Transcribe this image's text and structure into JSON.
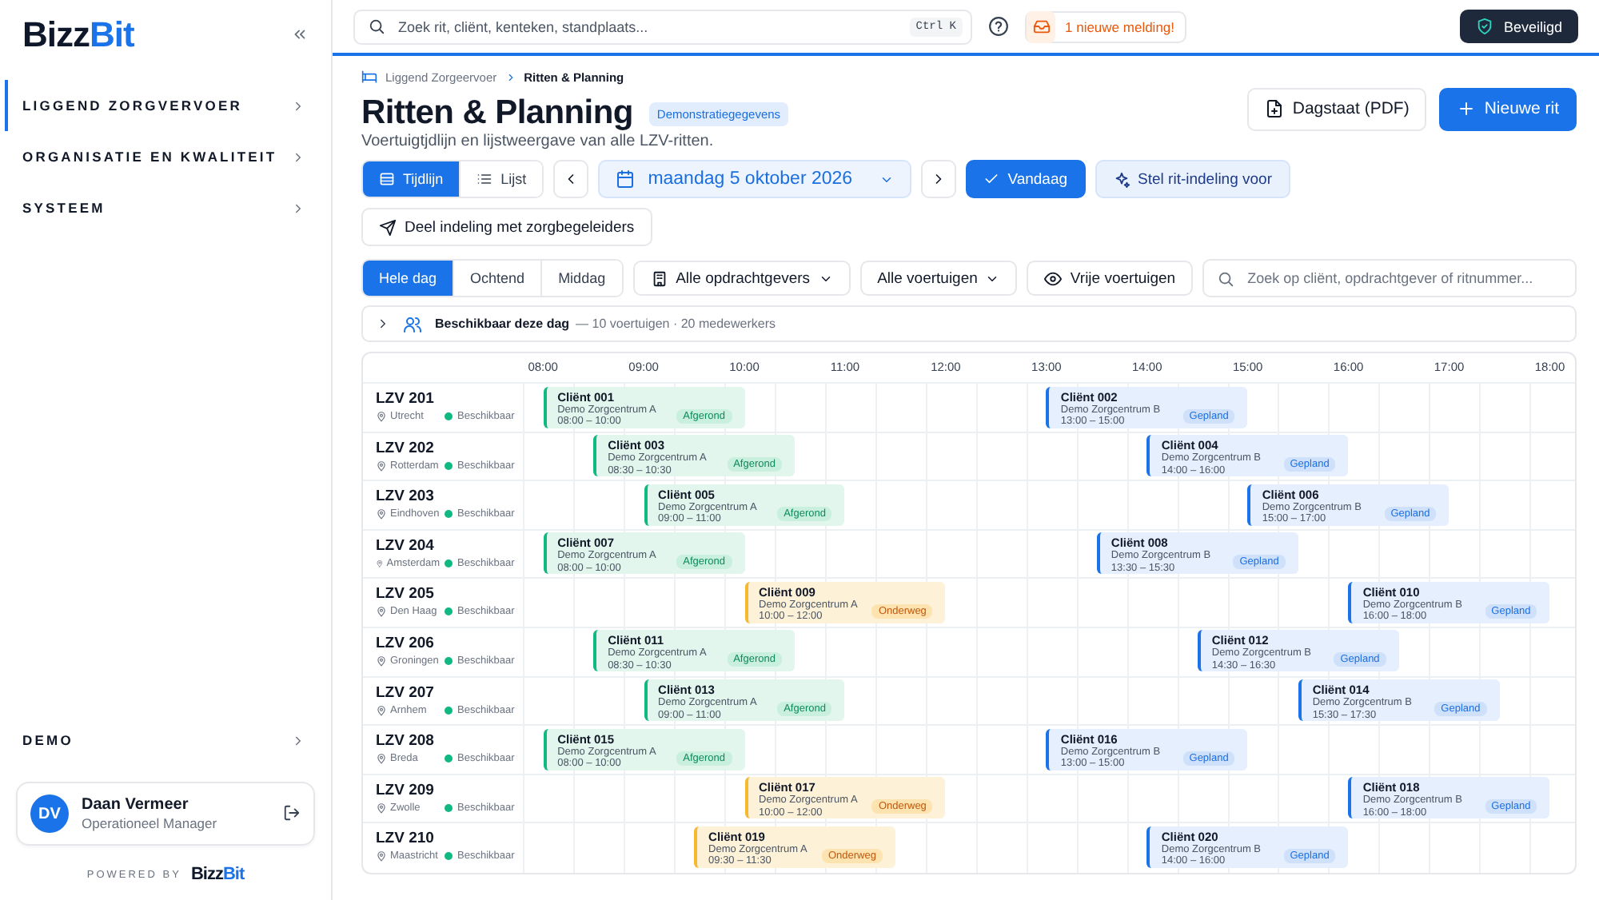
{
  "sidebar": {
    "logo": [
      "Bizz",
      "Bit"
    ],
    "items": [
      {
        "label": "LIGGEND ZORGVERVOER",
        "selected": true
      },
      {
        "label": "ORGANISATIE EN KWALITEIT",
        "selected": false
      },
      {
        "label": "SYSTEEM",
        "selected": false
      }
    ],
    "bottom_item": {
      "label": "DEMO"
    },
    "user": {
      "initials": "DV",
      "name": "Daan Vermeer",
      "role": "Operationeel Manager"
    },
    "powered_by": "POWERED BY",
    "powered_logo": [
      "Bizz",
      "Bit"
    ]
  },
  "topbar": {
    "search": {
      "placeholder": "Zoek rit, cliënt, kenteken, standplaats...",
      "shortcut": "Ctrl K"
    },
    "notification": "1 nieuwe melding!",
    "security": "Beveiligd"
  },
  "breadcrumb": [
    "Liggend Zorgeervoer",
    "Ritten & Planning"
  ],
  "title": "Ritten & Planning",
  "badge": "Demonstratiegegevens",
  "subtitle": "Voertuigtjdlijn en lijstweergave van alle LZV-ritten.",
  "actions": [
    "Dagstaat (PDF)",
    "Nieuwe rit"
  ],
  "views": [
    {
      "label": "Tijdlijn",
      "selected": true
    },
    {
      "label": "Lijst",
      "selected": false
    }
  ],
  "date": "maandag 5 oktober 2026",
  "today": "Vandaag",
  "suggest": "Stel rit-indeling voor",
  "share": "Deel indeling met zorgbegeleiders",
  "periods": [
    {
      "label": "Hele dag",
      "selected": true
    },
    {
      "label": "Ochtend",
      "selected": false
    },
    {
      "label": "Middag",
      "selected": false
    }
  ],
  "filters": {
    "clients": "Alle opdrachtgevers",
    "vehicles": "Alle voertuigen",
    "free": "Vrije voertuigen",
    "search_placeholder": "Zoek op cliënt, opdrachtgever of ritnummer..."
  },
  "availability": {
    "expanded": false,
    "label": "Beschikbaar deze dag",
    "detail": "— 10 voertuigen · 20 medewerkers"
  },
  "timeline": {
    "hours": [
      "08:00",
      "09:00",
      "10:00",
      "11:00",
      "12:00",
      "13:00",
      "14:00",
      "15:00",
      "16:00",
      "17:00",
      "18:00"
    ],
    "rows": [
      {
        "vehicle": "LZV 201",
        "city": "Utrecht",
        "status": "Beschikbaar",
        "available": true,
        "rides": [
          {
            "client": "Cliënt 001",
            "org": "Demo Zorgcentrum A",
            "time": "08:00 – 10:00",
            "kind": "done",
            "state": "Afgerond"
          },
          {
            "client": "Cliënt 002",
            "org": "Demo Zorgcentrum B",
            "time": "13:00 – 15:00",
            "kind": "planned",
            "state": "Gepland"
          }
        ]
      },
      {
        "vehicle": "LZV 202",
        "city": "Rotterdam",
        "status": "Beschikbaar",
        "available": true,
        "rides": [
          {
            "client": "Cliënt 003",
            "org": "Demo Zorgcentrum A",
            "time": "08:30 – 10:30",
            "kind": "done",
            "state": "Afgerond"
          },
          {
            "client": "Cliënt 004",
            "org": "Demo Zorgcentrum B",
            "time": "14:00 – 16:00",
            "kind": "planned",
            "state": "Gepland"
          }
        ]
      },
      {
        "vehicle": "LZV 203",
        "city": "Eindhoven",
        "status": "Beschikbaar",
        "available": true,
        "rides": [
          {
            "client": "Cliënt 005",
            "org": "Demo Zorgcentrum A",
            "time": "09:00 – 11:00",
            "kind": "done",
            "state": "Afgerond"
          },
          {
            "client": "Cliënt 006",
            "org": "Demo Zorgcentrum B",
            "time": "15:00 – 17:00",
            "kind": "planned",
            "state": "Gepland"
          }
        ]
      },
      {
        "vehicle": "LZV 204",
        "city": "Amsterdam",
        "status": "Beschikbaar",
        "available": true,
        "rides": [
          {
            "client": "Cliënt 007",
            "org": "Demo Zorgcentrum A",
            "time": "08:00 – 10:00",
            "kind": "done",
            "state": "Afgerond"
          },
          {
            "client": "Cliënt 008",
            "org": "Demo Zorgcentrum B",
            "time": "13:30 – 15:30",
            "kind": "planned",
            "state": "Gepland"
          }
        ]
      },
      {
        "vehicle": "LZV 205",
        "city": "Den Haag",
        "status": "Beschikbaar",
        "available": true,
        "rides": [
          {
            "client": "Cliënt 009",
            "org": "Demo Zorgcentrum A",
            "time": "10:00 – 12:00",
            "kind": "underway",
            "state": "Onderweg"
          },
          {
            "client": "Cliënt 010",
            "org": "Demo Zorgcentrum B",
            "time": "16:00 – 18:00",
            "kind": "planned",
            "state": "Gepland"
          }
        ]
      },
      {
        "vehicle": "LZV 206",
        "city": "Groningen",
        "status": "Beschikbaar",
        "available": true,
        "rides": [
          {
            "client": "Cliënt 011",
            "org": "Demo Zorgcentrum A",
            "time": "08:30 – 10:30",
            "kind": "done",
            "state": "Afgerond"
          },
          {
            "client": "Cliënt 012",
            "org": "Demo Zorgcentrum B",
            "time": "14:30 – 16:30",
            "kind": "planned",
            "state": "Gepland"
          }
        ]
      },
      {
        "vehicle": "LZV 207",
        "city": "Arnhem",
        "status": "Beschikbaar",
        "available": true,
        "rides": [
          {
            "client": "Cliënt 013",
            "org": "Demo Zorgcentrum A",
            "time": "09:00 – 11:00",
            "kind": "done",
            "state": "Afgerond"
          },
          {
            "client": "Cliënt 014",
            "org": "Demo Zorgcentrum B",
            "time": "15:30 – 17:30",
            "kind": "planned",
            "state": "Gepland"
          }
        ]
      },
      {
        "vehicle": "LZV 208",
        "city": "Breda",
        "status": "Beschikbaar",
        "available": true,
        "rides": [
          {
            "client": "Cliënt 015",
            "org": "Demo Zorgcentrum A",
            "time": "08:00 – 10:00",
            "kind": "done",
            "state": "Afgerond"
          },
          {
            "client": "Cliënt 016",
            "org": "Demo Zorgcentrum B",
            "time": "13:00 – 15:00",
            "kind": "planned",
            "state": "Gepland"
          }
        ]
      },
      {
        "vehicle": "LZV 209",
        "city": "Zwolle",
        "status": "Beschikbaar",
        "available": true,
        "rides": [
          {
            "client": "Cliënt 017",
            "org": "Demo Zorgcentrum A",
            "time": "10:00 – 12:00",
            "kind": "underway",
            "state": "Onderweg"
          },
          {
            "client": "Cliënt 018",
            "org": "Demo Zorgcentrum B",
            "time": "16:00 – 18:00",
            "kind": "planned",
            "state": "Gepland"
          }
        ]
      },
      {
        "vehicle": "LZV 210",
        "city": "Maastricht",
        "status": "Beschikbaar",
        "available": true,
        "rides": [
          {
            "client": "Cliënt 019",
            "org": "Demo Zorgcentrum A",
            "time": "09:30 – 11:30",
            "kind": "underway",
            "state": "Onderweg"
          },
          {
            "client": "Cliënt 020",
            "org": "Demo Zorgcentrum B",
            "time": "14:00 – 16:00",
            "kind": "planned",
            "state": "Gepland"
          }
        ]
      }
    ]
  }
}
